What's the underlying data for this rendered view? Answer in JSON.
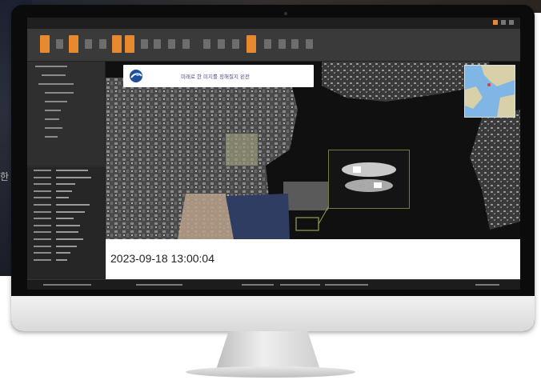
{
  "background": {
    "edge_label": "한"
  },
  "app": {
    "title": "",
    "banner_text": "미래로 한 미지를 정해질지 왼전",
    "timestamp": "2023-09-18 13:00:04"
  },
  "colors": {
    "accent": "#e7892f",
    "panel": "#2f2f2f",
    "frame": "#0b0b0b"
  },
  "icons": {
    "banner_logo": "globe-swirl-icon",
    "minimap": "region-minimap"
  }
}
